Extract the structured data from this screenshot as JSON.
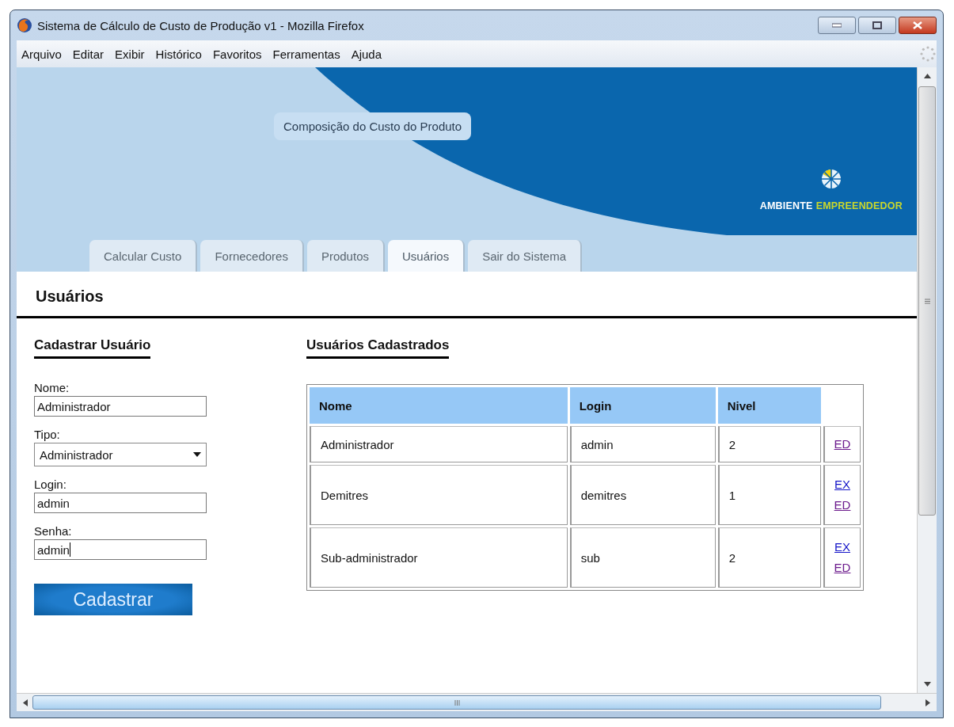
{
  "window": {
    "title": "Sistema de Cálculo de Custo de Produção v1 - Mozilla Firefox"
  },
  "menu": [
    "Arquivo",
    "Editar",
    "Exibir",
    "Histórico",
    "Favoritos",
    "Ferramentas",
    "Ajuda"
  ],
  "banner": {
    "title": "Composição do Custo do Produto",
    "logo": [
      {
        "text": "AMBIENTE",
        "color": "#ffffff"
      },
      {
        "text": "EMPREENDEDOR",
        "color": "#c9d72c"
      }
    ]
  },
  "tabs": [
    {
      "label": "Calcular Custo",
      "selected": false
    },
    {
      "label": "Fornecedores",
      "selected": false
    },
    {
      "label": "Produtos",
      "selected": false
    },
    {
      "label": "Usuários",
      "selected": true
    },
    {
      "label": "Sair do Sistema",
      "selected": false
    }
  ],
  "page_title": "Usuários",
  "form": {
    "title": "Cadastrar Usuário",
    "fields": [
      {
        "kind": "text",
        "label": "Nome:",
        "value": "Administrador"
      },
      {
        "kind": "select",
        "label": "Tipo:",
        "value": "Administrador"
      },
      {
        "kind": "text",
        "label": "Login:",
        "value": "admin"
      },
      {
        "kind": "text",
        "label": "Senha:",
        "value": "admin",
        "focused": true
      }
    ],
    "submit": "Cadastrar"
  },
  "table": {
    "title": "Usuários Cadastrados",
    "columns": [
      "Nome",
      "Login",
      "Nivel"
    ],
    "rows": [
      {
        "cells": [
          "Administrador",
          "admin",
          "2"
        ],
        "actions": [
          {
            "label": "ED",
            "visited": true
          }
        ]
      },
      {
        "cells": [
          "Demitres",
          "demitres",
          "1"
        ],
        "actions": [
          {
            "label": "EX",
            "visited": false
          },
          {
            "label": "ED",
            "visited": true
          }
        ]
      },
      {
        "cells": [
          "Sub-administrador",
          "sub",
          "2"
        ],
        "actions": [
          {
            "label": "EX",
            "visited": false
          },
          {
            "label": "ED",
            "visited": true
          }
        ]
      }
    ]
  }
}
